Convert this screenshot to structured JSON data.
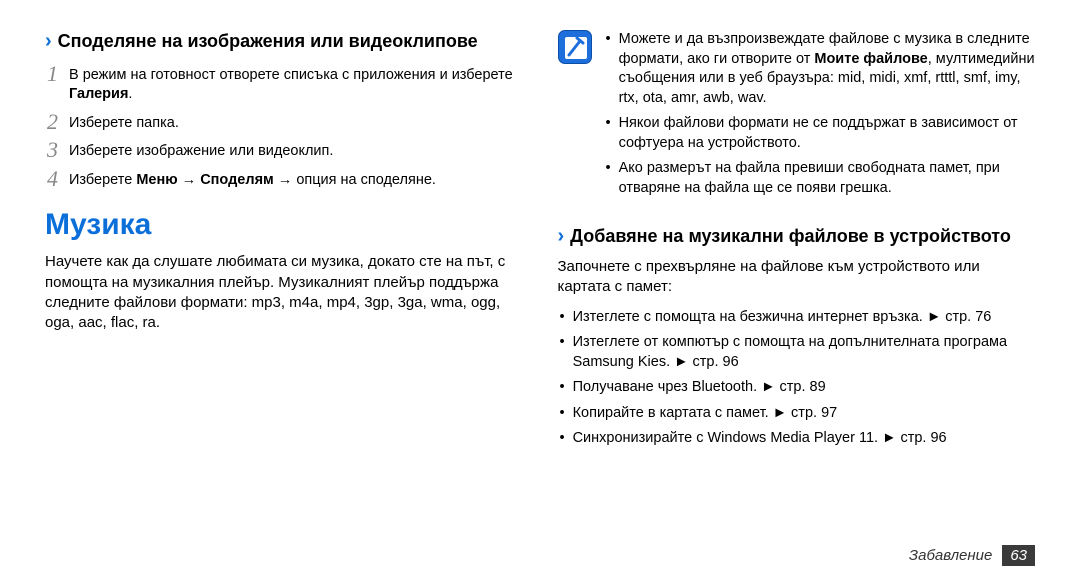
{
  "left": {
    "heading1": "Споделяне на изображения или видеоклипове",
    "steps": [
      {
        "n": "1",
        "pre": "В режим на готовност отворете списъка с приложения и изберете ",
        "bold": "Галерия",
        "post": "."
      },
      {
        "n": "2",
        "pre": "Изберете папка.",
        "bold": "",
        "post": ""
      },
      {
        "n": "3",
        "pre": "Изберете изображение или видеоклип.",
        "bold": "",
        "post": ""
      },
      {
        "n": "4",
        "pre": "Изберете ",
        "bold": "Меню",
        "mid": " → ",
        "bold2": "Споделям",
        "post": " → опция на споделяне."
      }
    ],
    "title": "Музика",
    "para": "Научете как да слушате любимата си музика, докато сте на път, с помощта на музикалния плейър. Музикалният плейър поддържа следните файлови формати: mp3, m4a, mp4, 3gp, 3ga, wma, ogg, oga, aac, flac, ra."
  },
  "right": {
    "note_bullets": [
      {
        "pre": "Можете и да възпроизвеждате файлове с музика в следните формати, ако ги отворите от ",
        "bold": "Моите файлове",
        "post": ", мултимедийни съобщения или в уеб браузъра: mid, midi, xmf, rtttl, smf, imy, rtx, ota, amr, awb, wav."
      },
      {
        "pre": "Някои файлови формати не се поддържат в зависимост от софтуера на устройството.",
        "bold": "",
        "post": ""
      },
      {
        "pre": "Ако размерът на файла превиши свободната памет, при отваряне на файла ще се появи грешка.",
        "bold": "",
        "post": ""
      }
    ],
    "heading2": "Добавяне на музикални файлове в устройството",
    "para2": "Започнете с прехвърляне на файлове към устройството или картата с памет:",
    "bullets2": [
      "Изтеглете с помощта на безжична интернет връзка. ► стр. 76",
      "Изтеглете от компютър с помощта на допълнителната програма Samsung Kies. ► стр. 96",
      "Получаване чрез Bluetooth. ► стр. 89",
      "Копирайте в картата с памет. ► стр. 97",
      "Синхронизирайте с Windows Media Player 11. ► стр. 96"
    ]
  },
  "footer": {
    "label": "Забавление",
    "page": "63"
  }
}
